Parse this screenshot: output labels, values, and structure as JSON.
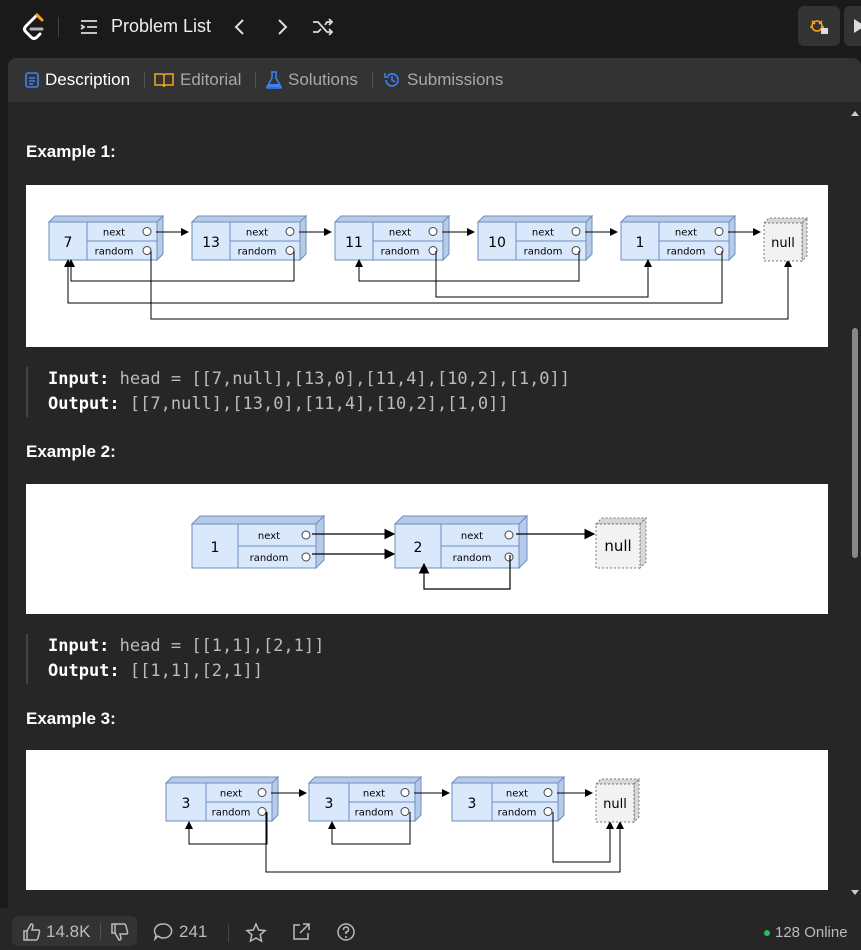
{
  "header": {
    "problem_list_label": "Problem List",
    "icons": [
      "leetcode-logo",
      "list-icon",
      "chevron-left-icon",
      "chevron-right-icon",
      "shuffle-icon",
      "debug-icon",
      "play-icon"
    ]
  },
  "tabs": [
    {
      "label": "Description",
      "icon": "document-icon",
      "active": true,
      "color": "#3b82f6"
    },
    {
      "label": "Editorial",
      "icon": "book-icon",
      "active": false,
      "color": "#f5a623"
    },
    {
      "label": "Solutions",
      "icon": "flask-icon",
      "active": false,
      "color": "#3b82f6"
    },
    {
      "label": "Submissions",
      "icon": "history-icon",
      "active": false,
      "color": "#3b82f6"
    }
  ],
  "examples": [
    {
      "title": "Example 1:",
      "input_label": "Input:",
      "input_value": "head = [[7,null],[13,0],[11,4],[10,2],[1,0]]",
      "output_label": "Output:",
      "output_value": "[[7,null],[13,0],[11,4],[10,2],[1,0]]",
      "nodes": [
        "7",
        "13",
        "11",
        "10",
        "1"
      ]
    },
    {
      "title": "Example 2:",
      "input_label": "Input:",
      "input_value": "head = [[1,1],[2,1]]",
      "output_label": "Output:",
      "output_value": "[[1,1],[2,1]]",
      "nodes": [
        "1",
        "2"
      ]
    },
    {
      "title": "Example 3:",
      "nodes": [
        "3",
        "3",
        "3"
      ]
    }
  ],
  "diagram_labels": {
    "next": "next",
    "random": "random",
    "null": "null"
  },
  "footer": {
    "likes": "14.8K",
    "comments": "241",
    "online": "128 Online",
    "online_color": "#2cbb5d"
  }
}
